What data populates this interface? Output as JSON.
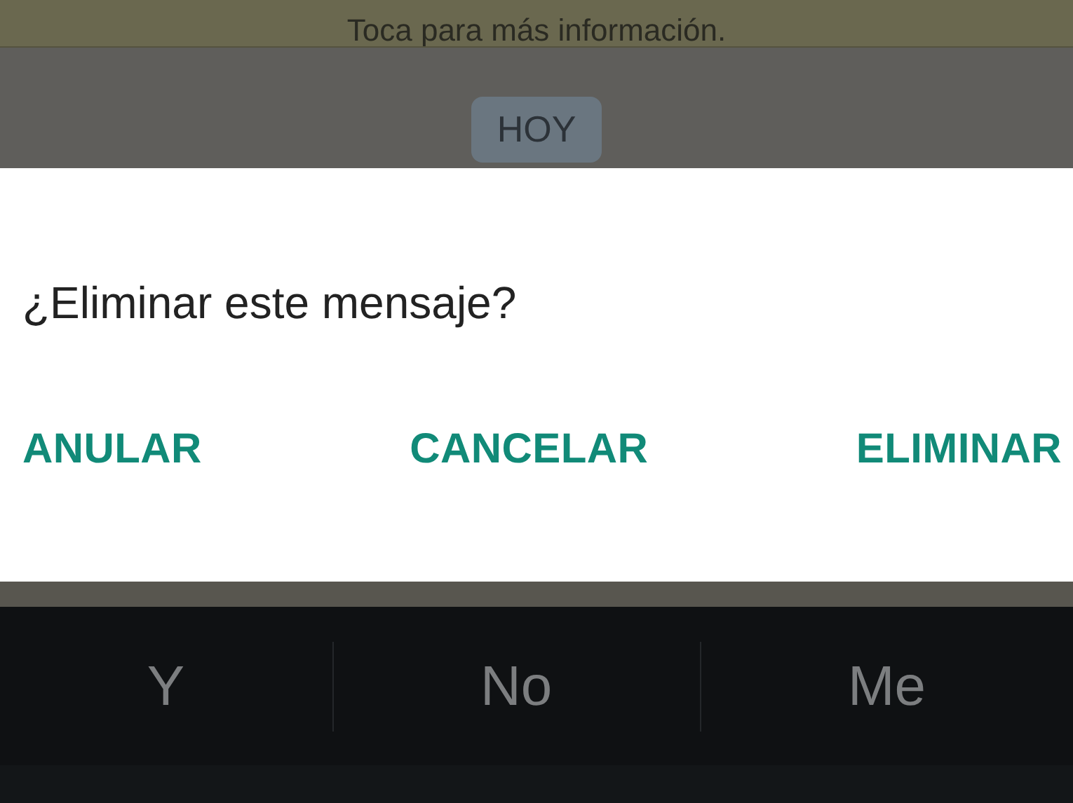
{
  "banner": {
    "text": "Toca para más información."
  },
  "date_chip": {
    "text": "HOY"
  },
  "dialog": {
    "title": "¿Eliminar este mensaje?",
    "buttons": [
      {
        "label": "ANULAR"
      },
      {
        "label": "CANCELAR"
      },
      {
        "label": "ELIMINAR"
      }
    ]
  },
  "keyboard": {
    "suggestions": [
      "Y",
      "No",
      "Me"
    ]
  }
}
